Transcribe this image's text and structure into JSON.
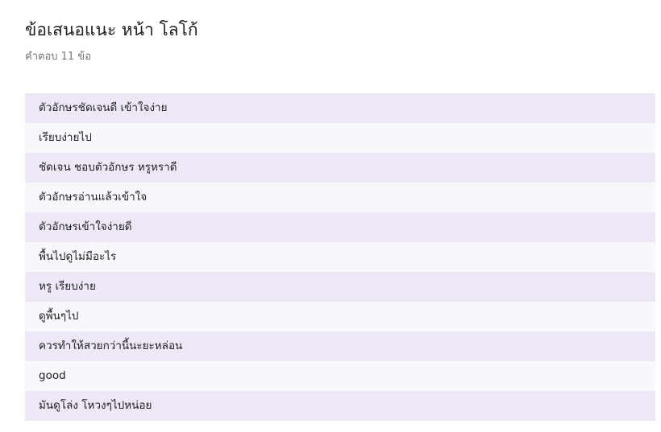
{
  "question": {
    "title": "ข้อเสนอแนะ หน้า โลโก้",
    "count_label": "คำตอบ 11 ข้อ"
  },
  "responses": [
    "ตัวอักษรชัดเจนดี เข้าใจง่าย",
    "เรียบง่ายไป",
    "ชัดเจน ชอบตัวอักษร หรูหราดี",
    "ตัวอักษรอ่านแล้วเข้าใจ",
    "ตัวอักษรเข้าใจง่ายดี",
    "พื้นไปดูไม่มีอะไร",
    "หรู เรียบง่าย",
    "ดูพื้นๆไป",
    "ควรทำให้สวยกว่านี้นะยะหล่อน",
    "good",
    "มันดูโล่ง โหวงๆไปหน่อย"
  ],
  "colors": {
    "row_odd": "#ede7f6",
    "row_even": "#f8f7fc",
    "text": "#202124",
    "muted_text": "#70757a"
  }
}
